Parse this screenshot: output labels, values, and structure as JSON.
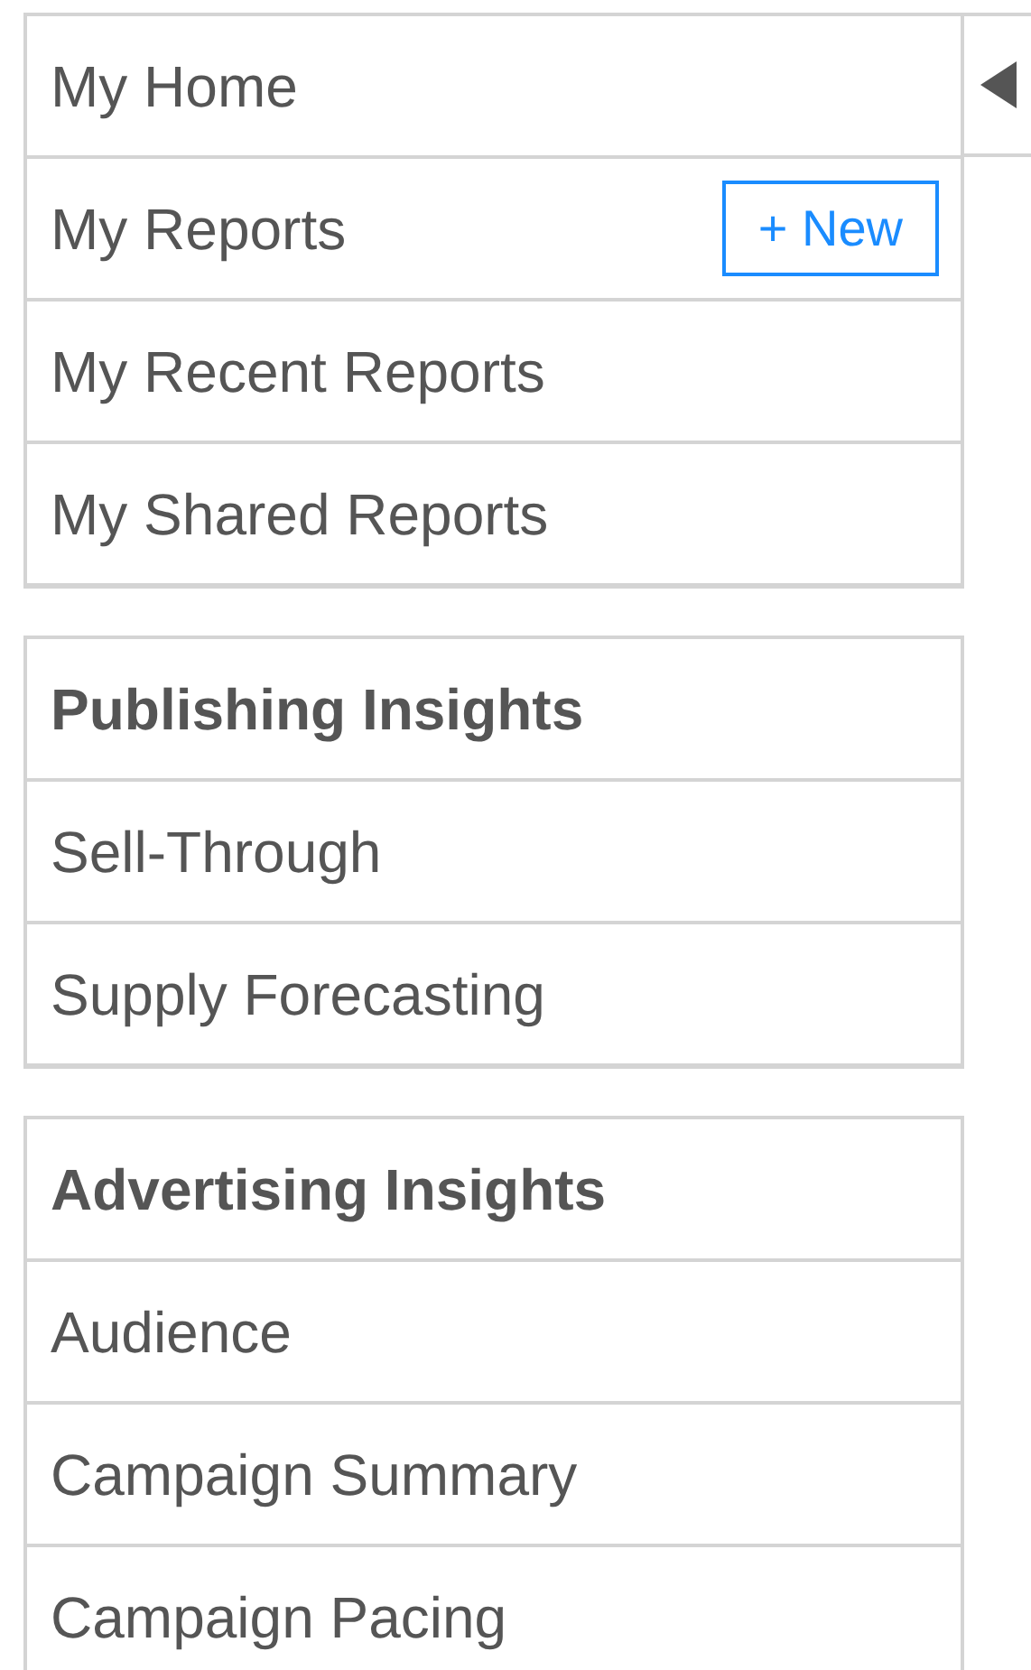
{
  "groups": [
    {
      "items": [
        {
          "label": "My Home"
        },
        {
          "label": "My Reports",
          "button": "+ New"
        },
        {
          "label": "My Recent Reports"
        },
        {
          "label": "My Shared Reports"
        }
      ]
    },
    {
      "title": "Publishing Insights",
      "items": [
        {
          "label": "Sell-Through"
        },
        {
          "label": "Supply Forecasting"
        }
      ]
    },
    {
      "title": "Advertising Insights",
      "items": [
        {
          "label": "Audience"
        },
        {
          "label": "Campaign Summary"
        },
        {
          "label": "Campaign Pacing"
        }
      ]
    }
  ],
  "sidebar": {
    "expanded": true
  }
}
